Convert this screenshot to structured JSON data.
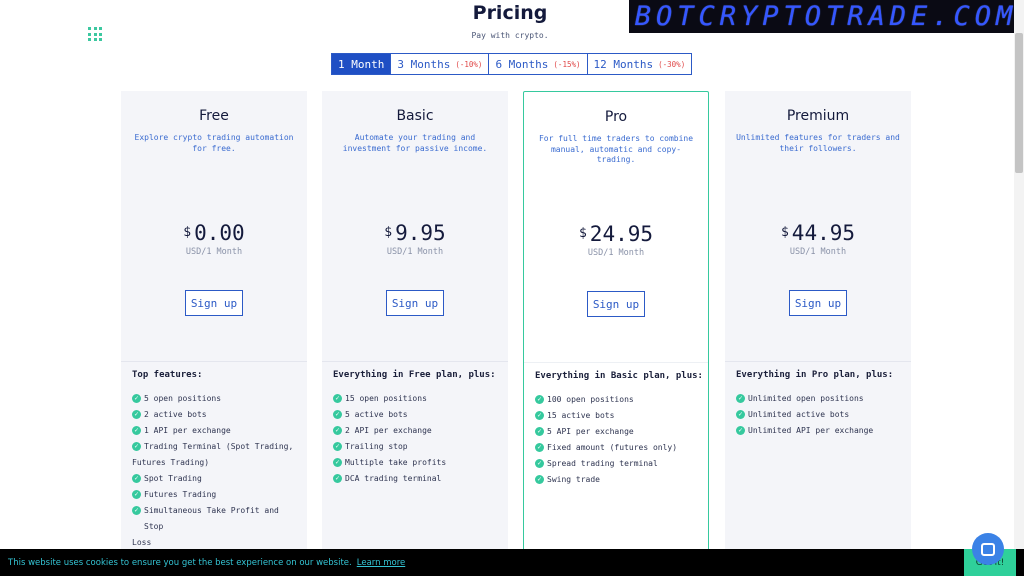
{
  "header": {
    "title": "Pricing",
    "subtitle": "Pay with crypto.",
    "logo_text": "BOTCRYPTOTRADE.COM"
  },
  "tabs": [
    {
      "label": "1 Month",
      "discount": "",
      "active": true
    },
    {
      "label": "3 Months",
      "discount": "(-10%)",
      "active": false
    },
    {
      "label": "6 Months",
      "discount": "(-15%)",
      "active": false
    },
    {
      "label": "12 Months",
      "discount": "(-30%)",
      "active": false
    }
  ],
  "plans": [
    {
      "name": "Free",
      "description": "Explore crypto trading automation for free.",
      "currency": "$",
      "price": "0.00",
      "period": "USD/1 Month",
      "button": "Sign up",
      "features_title": "Top features:",
      "features": [
        "5 open positions",
        "2 active bots",
        "1 API per exchange",
        "Trading Terminal (Spot Trading,",
        "Futures Trading)",
        "Spot Trading",
        "Futures Trading",
        "Simultaneous Take Profit and Stop",
        "Loss"
      ]
    },
    {
      "name": "Basic",
      "description": "Automate your trading and investment for passive income.",
      "currency": "$",
      "price": "9.95",
      "period": "USD/1 Month",
      "button": "Sign up",
      "features_title": "Everything in Free plan, plus:",
      "features": [
        "15 open positions",
        "5 active bots",
        "2 API per exchange",
        "Trailing stop",
        "Multiple take profits",
        "DCA trading terminal"
      ]
    },
    {
      "name": "Pro",
      "description": "For full time traders to combine manual, automatic and copy-trading.",
      "currency": "$",
      "price": "24.95",
      "period": "USD/1 Month",
      "button": "Sign up",
      "features_title": "Everything in Basic plan, plus:",
      "features": [
        "100 open positions",
        "15 active bots",
        "5 API per exchange",
        "Fixed amount (futures only)",
        "Spread trading terminal",
        "Swing trade"
      ]
    },
    {
      "name": "Premium",
      "description": "Unlimited features for traders and their followers.",
      "currency": "$",
      "price": "44.95",
      "period": "USD/1 Month",
      "button": "Sign up",
      "features_title": "Everything in Pro plan, plus:",
      "features": [
        "Unlimited open positions",
        "Unlimited active bots",
        "Unlimited API per exchange"
      ]
    }
  ],
  "cookie": {
    "text": "This website uses cookies to ensure you get the best experience on our website.",
    "link": "Learn more",
    "button": "Got it!"
  },
  "icons": {
    "apps": "grid-dots-icon",
    "check": "check-circle-icon",
    "chat": "chat-bubble-icon"
  },
  "colors": {
    "accent": "#1f4fc4",
    "check": "#36c99e",
    "discount": "#e04848",
    "logo": "#3557ff"
  }
}
